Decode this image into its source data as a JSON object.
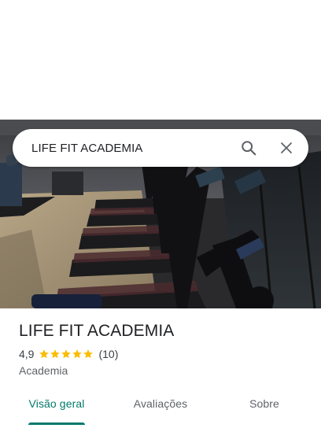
{
  "search": {
    "query": "LIFE FIT ACADEMIA",
    "search_icon": "search-icon",
    "close_icon": "close-icon"
  },
  "photo": {
    "subject": "gym-treadmills-photo"
  },
  "place": {
    "name": "LIFE FIT ACADEMIA",
    "rating": "4,9",
    "stars": 5,
    "reviews": "(10)",
    "category": "Academia"
  },
  "tabs": [
    {
      "label": "Visão geral",
      "active": true
    },
    {
      "label": "Avaliações",
      "active": false
    },
    {
      "label": "Sobre",
      "active": false
    }
  ],
  "colors": {
    "accent": "#00796b",
    "star": "#fbbc04"
  }
}
